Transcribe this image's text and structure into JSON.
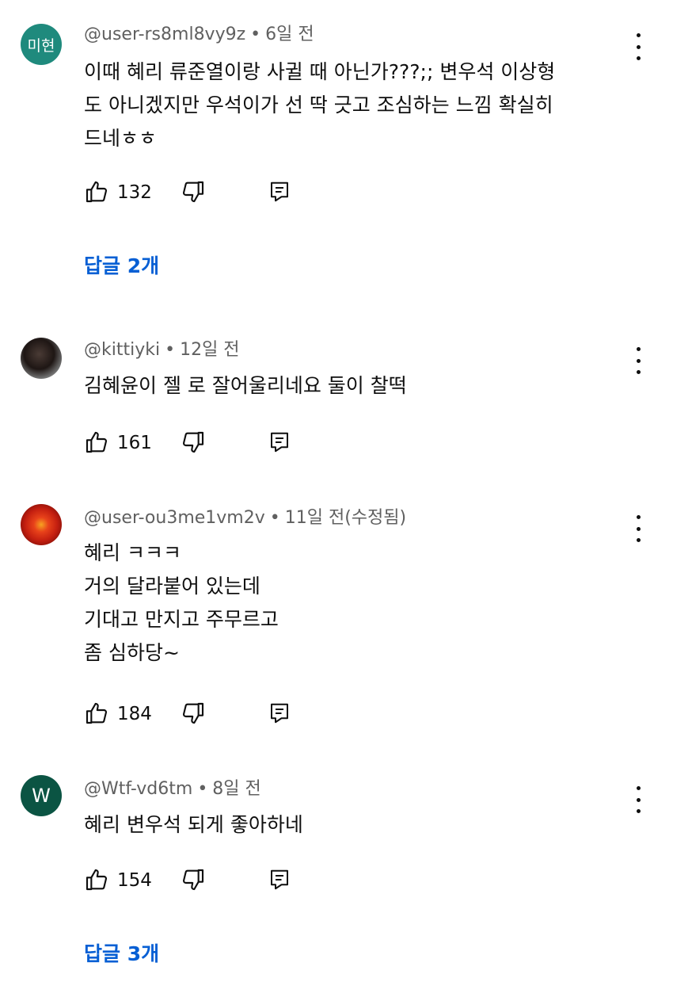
{
  "comments": [
    {
      "avatar_text": "미현",
      "handle": "@user-rs8ml8vy9z",
      "time": "6일 전",
      "lines": [
        "이때 혜리 류준열이랑 사귈 때 아닌가???;; 변우석 이상형",
        "도 아니겠지만 우석이가 선 딱 긋고 조심하는 느낌 확실히",
        "드네ㅎㅎ"
      ],
      "likes": "132",
      "replies": "답글 2개",
      "avatar_color": "#1f8a7d"
    },
    {
      "avatar_text": "",
      "handle": "@kittiyki",
      "time": "12일 전",
      "lines": [
        "김혜윤이 젤 로 잘어울리네요 둘이 찰떡"
      ],
      "likes": "161",
      "replies": ""
    },
    {
      "avatar_text": "",
      "handle": "@user-ou3me1vm2v",
      "time": "11일 전(수정됨)",
      "lines": [
        "혜리 ㅋㅋㅋ",
        "거의 달라붙어 있는데",
        "기대고 만지고 주무르고",
        "좀 심하당~"
      ],
      "likes": "184",
      "replies": ""
    },
    {
      "avatar_text": "W",
      "handle": "@Wtf-vd6tm",
      "time": "8일 전",
      "lines": [
        "혜리 변우석 되게 좋아하네"
      ],
      "likes": "154",
      "replies": "답글 3개",
      "avatar_color": "#0b5443"
    }
  ],
  "separator": "•",
  "colors": {
    "link": "#065fd4",
    "meta": "#606060",
    "text": "#0f0f0f"
  },
  "icons": {
    "like": "thumbs-up-icon",
    "dislike": "thumbs-down-icon",
    "reply": "reply-icon",
    "more": "more-vert-icon"
  }
}
